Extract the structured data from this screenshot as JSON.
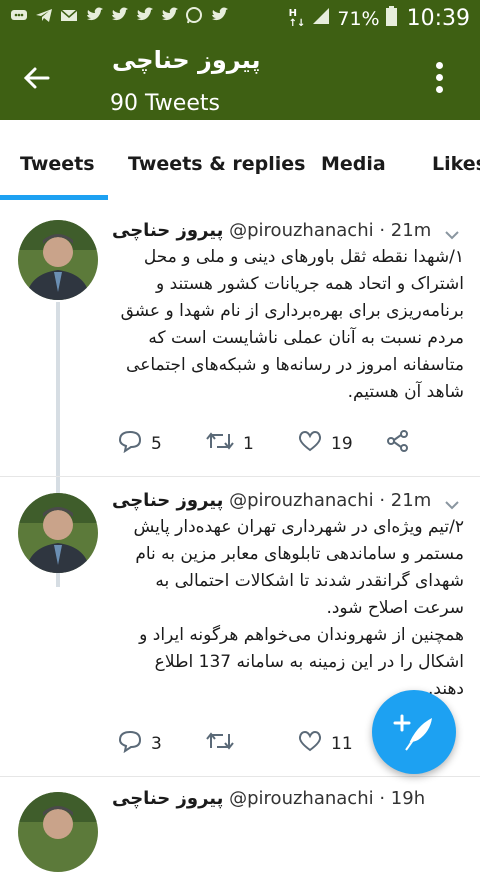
{
  "status_bar": {
    "battery_percent": "71%",
    "time": "10:39",
    "notification_icons": [
      "message-icon",
      "telegram-icon",
      "mail-icon",
      "twitter-icon",
      "twitter-icon",
      "twitter-icon",
      "twitter-icon",
      "whatsapp-icon",
      "twitter-icon"
    ]
  },
  "header": {
    "title": "پیروز حناچی",
    "subtitle": "90 Tweets",
    "background": "#3e6013"
  },
  "tabs": [
    {
      "label": "Tweets",
      "selected": true
    },
    {
      "label": "Tweets & replies",
      "selected": false
    },
    {
      "label": "Media",
      "selected": false
    },
    {
      "label": "Likes",
      "selected": false
    }
  ],
  "accent_color": "#1da1f2",
  "tweets": [
    {
      "name": "پیروز حناچی",
      "handle": "@pirouzhanachi",
      "time": "· 21m",
      "text": [
        "۱/شهدا نقطه ثقل باورهای دینی و ملی و محل",
        "اشتراک و اتحاد همه جریانات کشور هستند و",
        "برنامه‌ریزی برای بهره‌برداری از نام شهدا و عشق",
        "مردم نسبت به آنان عملی ناشایست است که",
        "متاسفانه امروز در رسانه‌ها و شبکه‌های اجتماعی",
        "شاهد آن هستیم."
      ],
      "replies": "5",
      "retweets": "1",
      "likes": "19"
    },
    {
      "name": "پیروز حناچی",
      "handle": "@pirouzhanachi",
      "time": "· 21m",
      "text": [
        "۲/تیم ویژه‌ای در شهرداری تهران عهده‌دار پایش",
        "مستمر و ساماندهی تابلوهای معابر مزین به نام",
        "شهدای گرانقدر شدند تا اشکالات احتمالی به",
        "سرعت اصلاح شود.",
        "همچنین از شهروندان می‌خواهم هرگونه ایراد و",
        "اشکال را در این زمینه به سامانه 137 اطلاع",
        "دهند."
      ],
      "replies": "3",
      "retweets": "",
      "likes": "11"
    },
    {
      "name": "پیروز حناچی",
      "handle": "@pirouzhanachi",
      "time": "· 19h"
    }
  ]
}
